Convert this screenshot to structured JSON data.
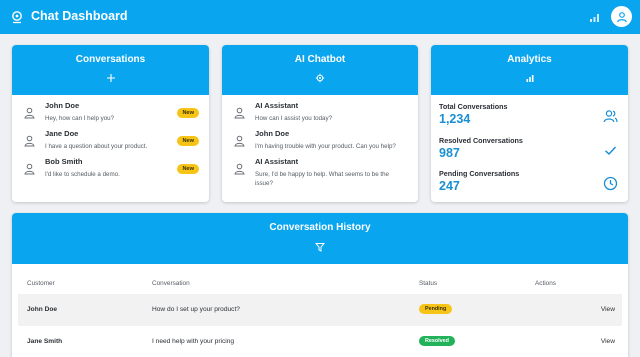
{
  "header": {
    "title": "Chat Dashboard",
    "logo_icon": "location-pin-icon",
    "signal_icon": "signal-icon",
    "avatar_icon": "user-icon"
  },
  "colors": {
    "primary": "#0aa5ef",
    "badge_new": "#f6c417",
    "pending": "#f6c417",
    "resolved": "#22b35a",
    "stat_value": "#1a8fd1"
  },
  "conversations": {
    "title": "Conversations",
    "icon": "plus-icon",
    "items": [
      {
        "name": "John Doe",
        "message": "Hey, how can I help you?",
        "badge": "New"
      },
      {
        "name": "Jane Doe",
        "message": "I have a question about your product.",
        "badge": "New"
      },
      {
        "name": "Bob Smith",
        "message": "I'd like to schedule a demo.",
        "badge": "New"
      }
    ]
  },
  "chatbot": {
    "title": "AI Chatbot",
    "icon": "gear-icon",
    "items": [
      {
        "name": "AI Assistant",
        "message": "How can I assist you today?"
      },
      {
        "name": "John Doe",
        "message": "I'm having trouble with your product. Can you help?"
      },
      {
        "name": "AI Assistant",
        "message": "Sure, I'd be happy to help. What seems to be the issue?"
      }
    ]
  },
  "analytics": {
    "title": "Analytics",
    "icon": "bar-chart-icon",
    "stats": [
      {
        "label": "Total Conversations",
        "value": "1,234",
        "icon": "users-icon"
      },
      {
        "label": "Resolved Conversations",
        "value": "987",
        "icon": "check-icon"
      },
      {
        "label": "Pending Conversations",
        "value": "247",
        "icon": "clock-icon"
      }
    ]
  },
  "history": {
    "title": "Conversation History",
    "icon": "filter-icon",
    "columns": [
      "Customer",
      "Conversation",
      "Status",
      "Actions"
    ],
    "rows": [
      {
        "customer": "John Doe",
        "conversation": "How do I set up your product?",
        "status": "Pending",
        "action": "View"
      },
      {
        "customer": "Jane Smith",
        "conversation": "I need help with your pricing",
        "status": "Resolved",
        "action": "View"
      }
    ]
  }
}
